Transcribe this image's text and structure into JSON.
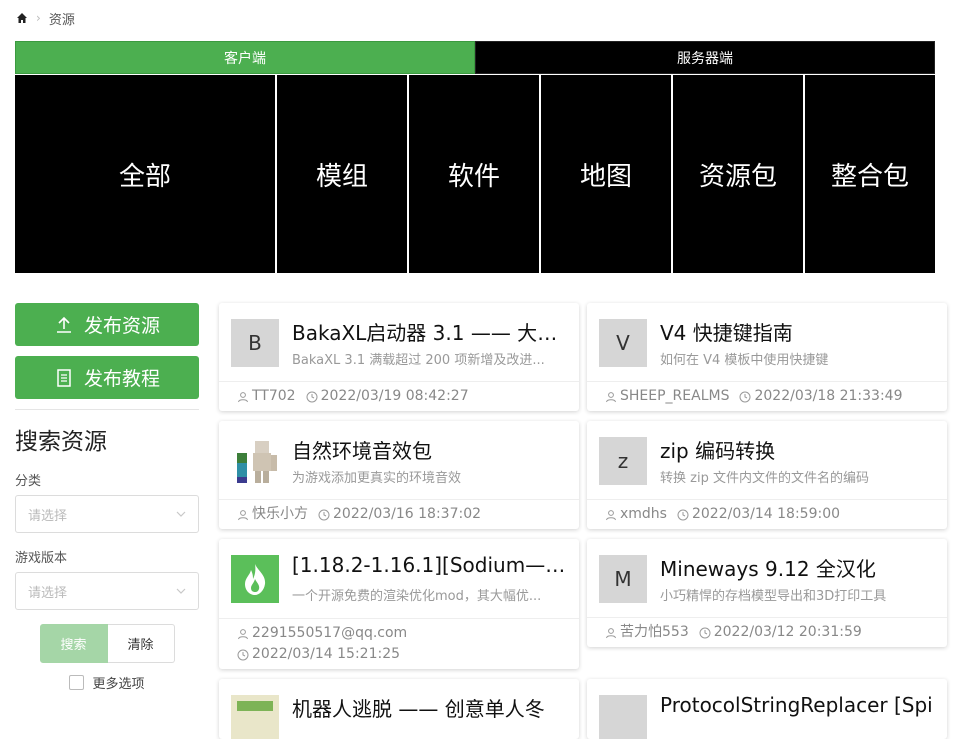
{
  "breadcrumb": {
    "current": "资源"
  },
  "tabs": [
    {
      "label": "客户端"
    },
    {
      "label": "服务器端"
    }
  ],
  "categories": [
    "全部",
    "模组",
    "软件",
    "地图",
    "资源包",
    "整合包"
  ],
  "sidebar": {
    "publish_resource": "发布资源",
    "publish_tutorial": "发布教程",
    "search_title": "搜索资源",
    "category_label": "分类",
    "category_placeholder": "请选择",
    "version_label": "游戏版本",
    "version_placeholder": "请选择",
    "search_button": "搜索",
    "clear_button": "清除",
    "more_options": "更多选项"
  },
  "cards": [
    {
      "thumb": "B",
      "title": "BakaXL启动器 3.1 —— 大的...",
      "desc": "BakaXL 3.1 满载超过 200 项新增及改进...",
      "author": "TT702",
      "date": "2022/03/19 08:42:27"
    },
    {
      "thumb": "V",
      "title": "V4 快捷键指南",
      "desc": "如何在 V4 模板中使用快捷键",
      "author": "SHEEP_REALMS",
      "date": "2022/03/18 21:33:49"
    },
    {
      "thumb": "",
      "title": "自然环境音效包",
      "desc": "为游戏添加更真实的环境音效",
      "author": "快乐小方",
      "date": "2022/03/16 18:37:02"
    },
    {
      "thumb": "z",
      "title": "zip 编码转换",
      "desc": "转换 zip 文件内文件的文件名的编码",
      "author": "xmdhs",
      "date": "2022/03/14 18:59:00"
    },
    {
      "thumb": "",
      "title": "[1.18.2-1.16.1][Sodium——...",
      "desc": "一个开源免费的渲染优化mod，其大幅优...",
      "author": "2291550517@qq.com",
      "date": "2022/03/14 15:21:25"
    },
    {
      "thumb": "M",
      "title": "Mineways 9.12 全汉化",
      "desc": "小巧精悍的存档模型导出和3D打印工具",
      "author": "苦力怕553",
      "date": "2022/03/12 20:31:59"
    },
    {
      "thumb": "",
      "title": "机器人逃脱 —— 创意单人冬",
      "desc": "",
      "author": "",
      "date": ""
    },
    {
      "thumb": "",
      "title": "ProtocolStringReplacer [Spi",
      "desc": "",
      "author": "",
      "date": ""
    }
  ],
  "colors": {
    "accent": "#4caf50",
    "accent_light": "#a5d6a7",
    "tile": "#000000"
  }
}
